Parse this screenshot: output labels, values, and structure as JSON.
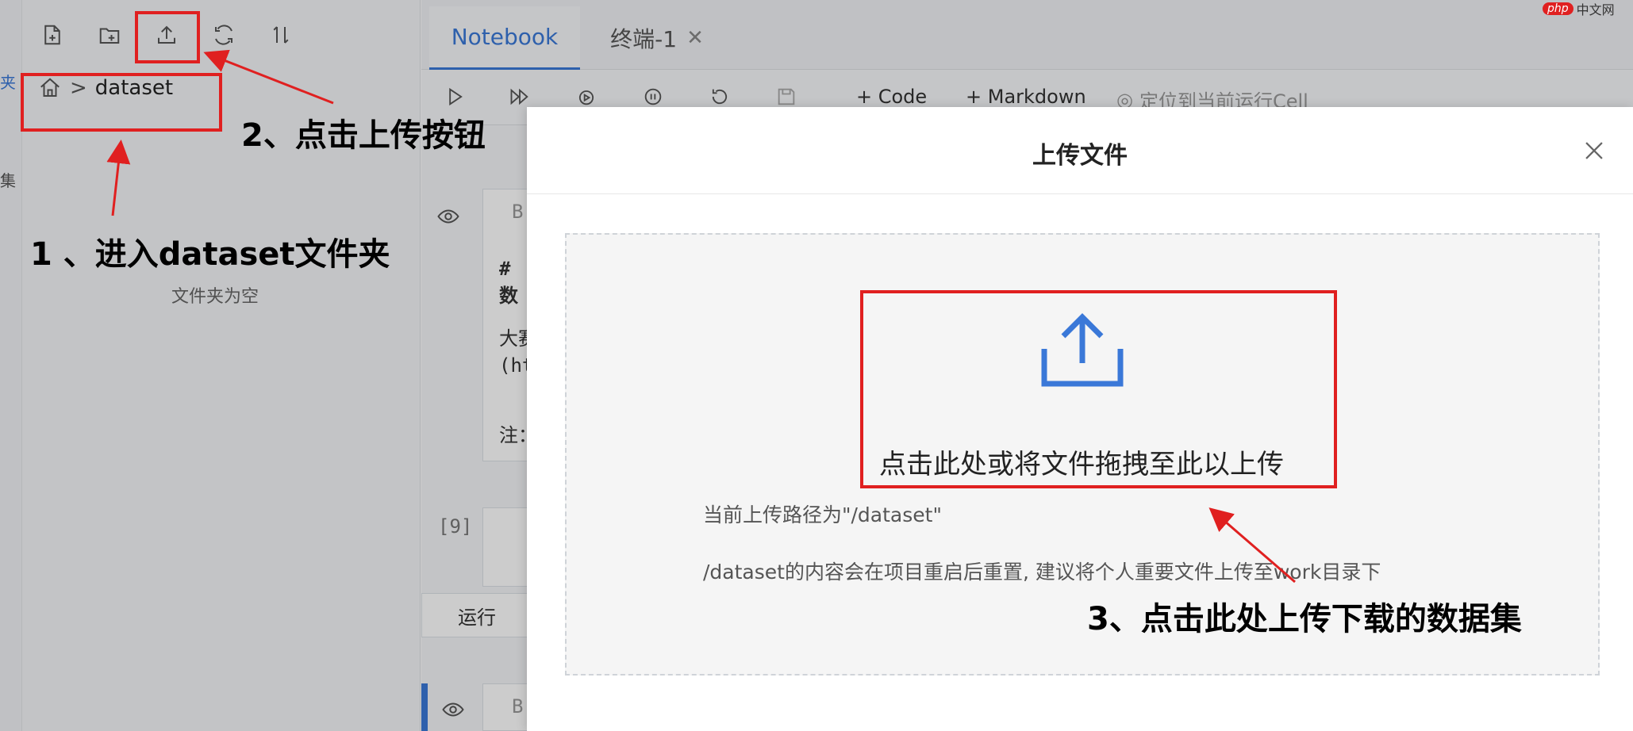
{
  "sidebar": {
    "toolbar_icons": [
      "new-file-icon",
      "new-folder-icon",
      "upload-icon",
      "refresh-icon",
      "sort-icon"
    ],
    "breadcrumb_current": "dataset",
    "breadcrumb_separator": ">",
    "empty_text": "文件夹为空"
  },
  "tabs": [
    {
      "label": "Notebook",
      "active": true
    },
    {
      "label": "终端-1",
      "active": false
    }
  ],
  "toolbar": {
    "add_code": "+ Code",
    "add_markdown": "+ Markdown",
    "locate_cell": "定位到当前运行Cell"
  },
  "notebook": {
    "cell_prefix_1": "B",
    "line_1": "# 数",
    "line_2": "大赛",
    "line_3": "(ht",
    "line_4": "注：",
    "exec_count": "[9]",
    "run_label": "运行",
    "cell_prefix_2": "B"
  },
  "modal": {
    "title": "上传文件",
    "drop_hint": "点击此处或将文件拖拽至此以上传",
    "path_info": "当前上传路径为\"/dataset\"",
    "warning": "/dataset的内容会在项目重启后重置, 建议将个人重要文件上传至work目录下"
  },
  "annotations": {
    "step1": "1 、进入dataset文件夹",
    "step2": "2、点击上传按钮",
    "step3": "3、点击此处上传下载的数据集"
  },
  "watermark": "中文网",
  "colors": {
    "accent": "#3a78d8",
    "annotation_red": "#e02020",
    "upload_icon": "#3a78d8"
  }
}
